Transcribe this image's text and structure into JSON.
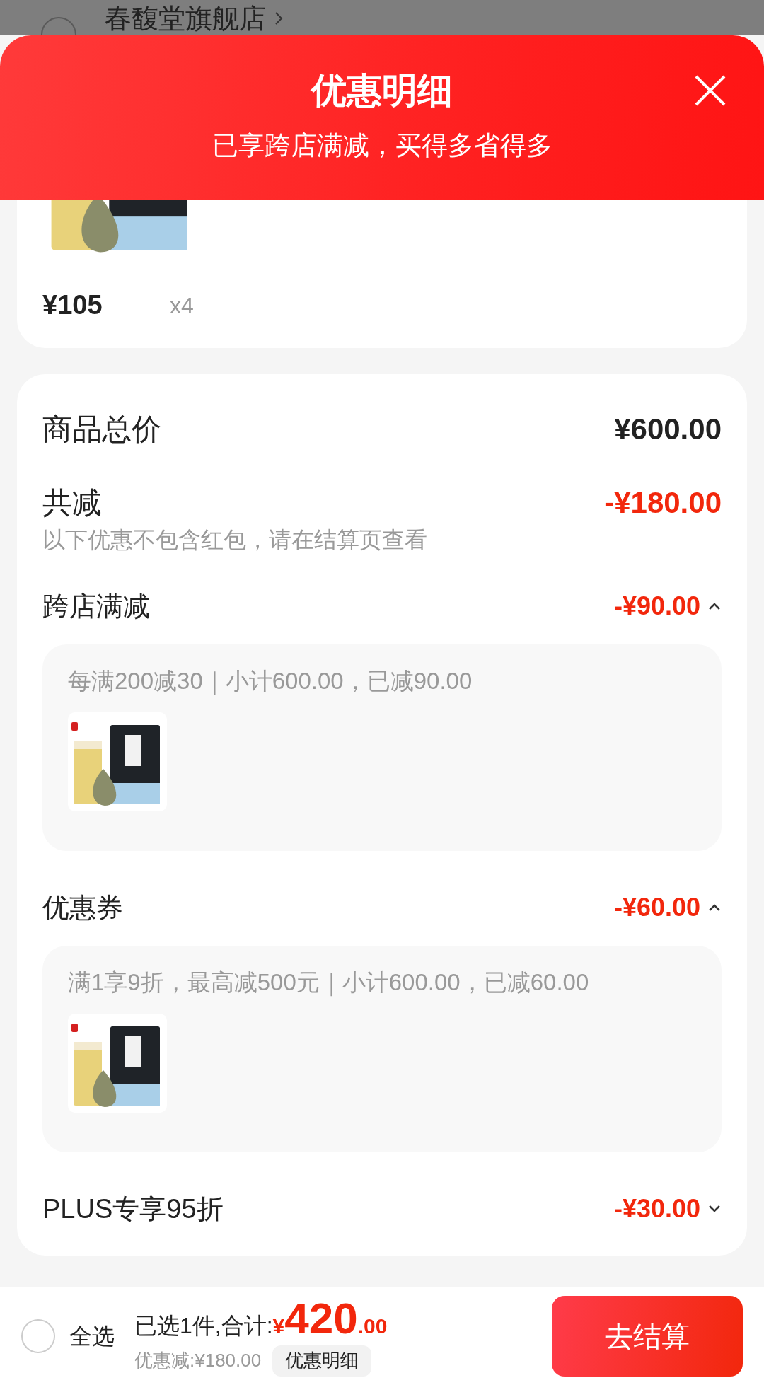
{
  "store": {
    "name": "春馥堂旗舰店",
    "selected": false
  },
  "sheet": {
    "title": "优惠明细",
    "subtitle": "已享跨店满减，买得多省得多"
  },
  "product": {
    "price": "¥105",
    "quantity": "x4"
  },
  "summary": {
    "total_label": "商品总价",
    "total_value": "¥600.00",
    "discount_label": "共减",
    "discount_value": "-¥180.00",
    "note": "以下优惠不包含红包，请在结算页查看"
  },
  "discounts": [
    {
      "name": "跨店满减",
      "amount": "-¥90.00",
      "expanded": true,
      "detail": "每满200减30｜小计600.00，已减90.00"
    },
    {
      "name": "优惠券",
      "amount": "-¥60.00",
      "expanded": true,
      "detail": "满1享9折，最高减500元｜小计600.00，已减60.00"
    },
    {
      "name": "PLUS专享95折",
      "amount": "-¥30.00",
      "expanded": false
    }
  ],
  "bottom_bar": {
    "select_all": {
      "label": "全选",
      "checked": false
    },
    "selected_text": "已选1件,合计:",
    "currency": "¥",
    "total_int": "420",
    "total_dec": ".00",
    "saved": "优惠减:¥180.00",
    "details_button": "优惠明细",
    "checkout": "去结算"
  }
}
